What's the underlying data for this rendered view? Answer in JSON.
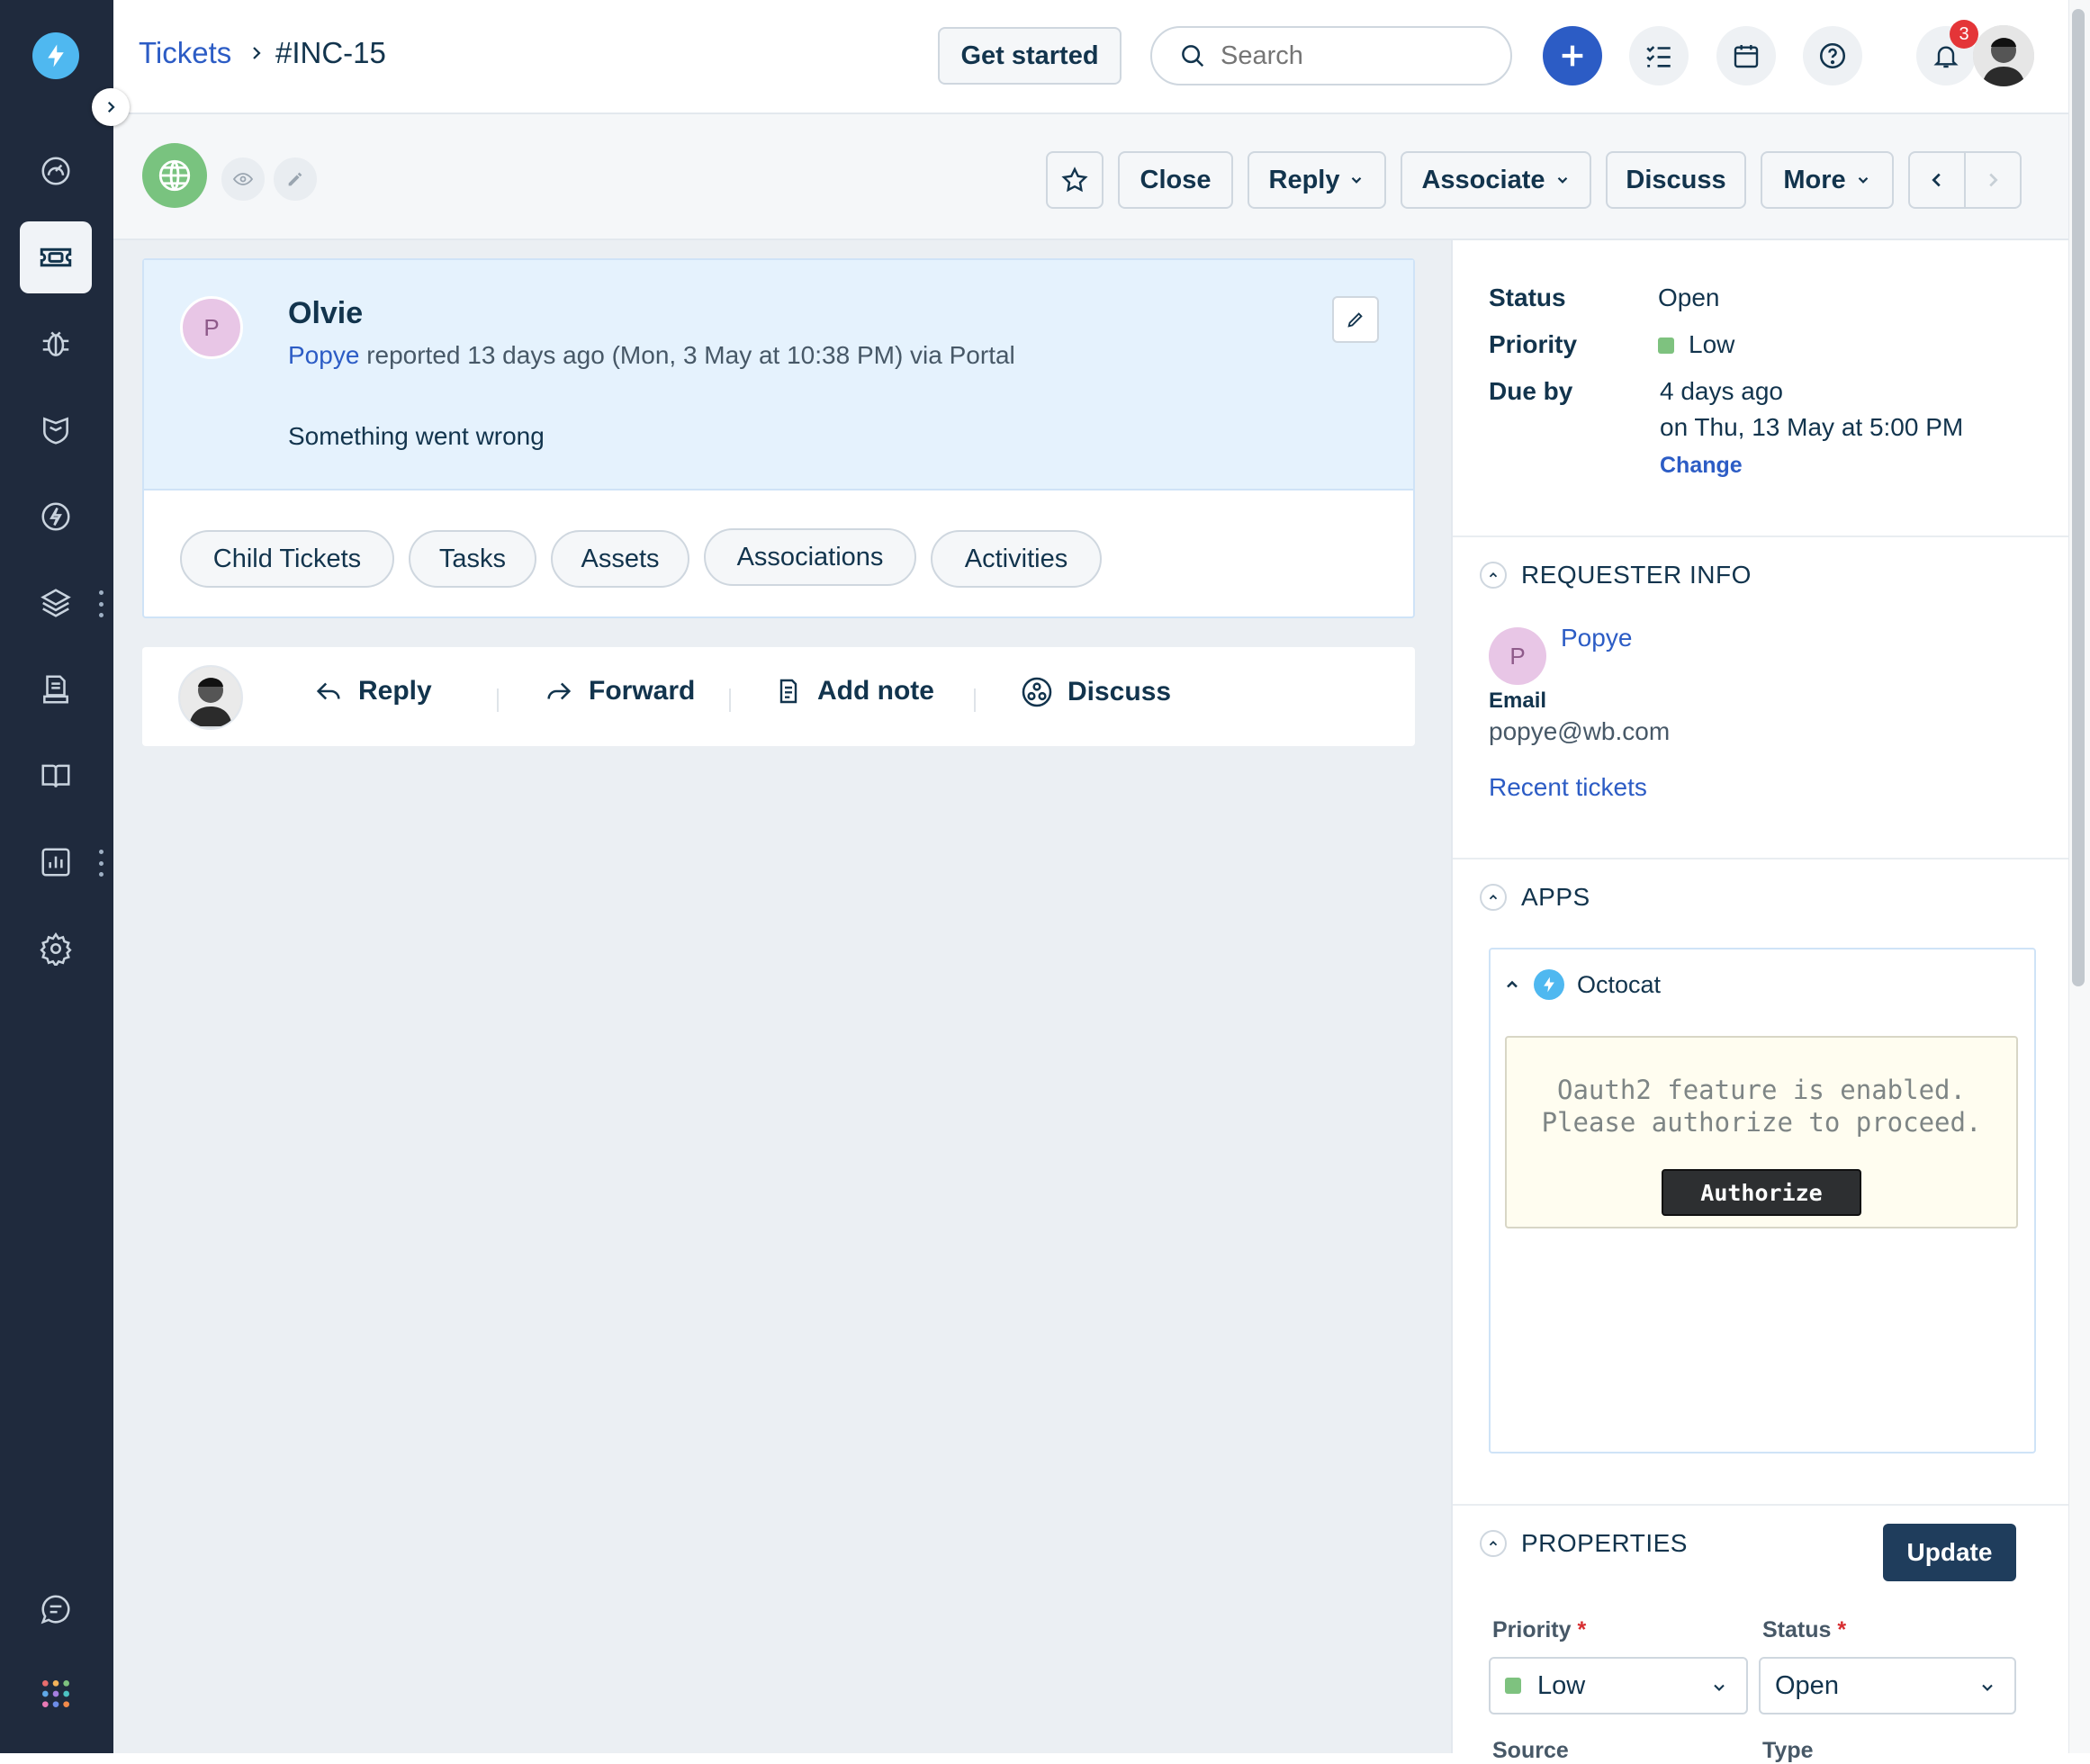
{
  "header": {
    "breadcrumb_root": "Tickets",
    "breadcrumb_current": "#INC-15",
    "get_started_label": "Get started",
    "search_placeholder": "Search",
    "help_badge_count": "3"
  },
  "toolbar": {
    "close_label": "Close",
    "reply_label": "Reply",
    "associate_label": "Associate",
    "discuss_label": "Discuss",
    "more_label": "More"
  },
  "ticket": {
    "subject": "Olvie",
    "requester_initial": "P",
    "requester_name": "Popye",
    "reported_text": "reported 13 days ago (Mon, 3 May at 10:38 PM) via Portal",
    "description": "Something went wrong",
    "tabs": [
      "Child Tickets",
      "Tasks",
      "Assets",
      "Associations",
      "Activities"
    ]
  },
  "reply_actions": {
    "reply": "Reply",
    "forward": "Forward",
    "add_note": "Add note",
    "discuss": "Discuss"
  },
  "sidepanel": {
    "status_label": "Status",
    "status_value": "Open",
    "priority_label": "Priority",
    "priority_value": "Low",
    "due_label": "Due by",
    "due_relative": "4 days ago",
    "due_absolute": "on Thu, 13 May at 5:00 PM",
    "change_link": "Change",
    "requester_section": "REQUESTER INFO",
    "requester_initial": "P",
    "requester_name": "Popye",
    "email_label": "Email",
    "email_value": "popye@wb.com",
    "recent_tickets_link": "Recent tickets",
    "apps_section": "APPS",
    "app_name": "Octocat",
    "oauth_message": "Oauth2 feature is enabled.\nPlease authorize to proceed.",
    "authorize_label": "Authorize",
    "properties_section": "PROPERTIES",
    "update_label": "Update",
    "prop_priority_label": "Priority",
    "prop_status_label": "Status",
    "prop_priority_value": "Low",
    "prop_status_value": "Open",
    "prop_source_label": "Source",
    "prop_type_label": "Type",
    "required_marker": "*"
  },
  "colors": {
    "nav_bg": "#1f2a3d",
    "link": "#2c5cc5",
    "priority_low": "#7ec27f",
    "card_bg": "#e5f2fd",
    "badge": "#e43538"
  },
  "icons": {
    "nav": [
      "dashboard-icon",
      "tickets-icon",
      "problems-icon",
      "changes-icon",
      "releases-icon",
      "assets-icon",
      "contracts-icon",
      "solutions-icon",
      "analytics-icon",
      "admin-icon",
      "chat-icon",
      "apps-grid-icon"
    ]
  }
}
